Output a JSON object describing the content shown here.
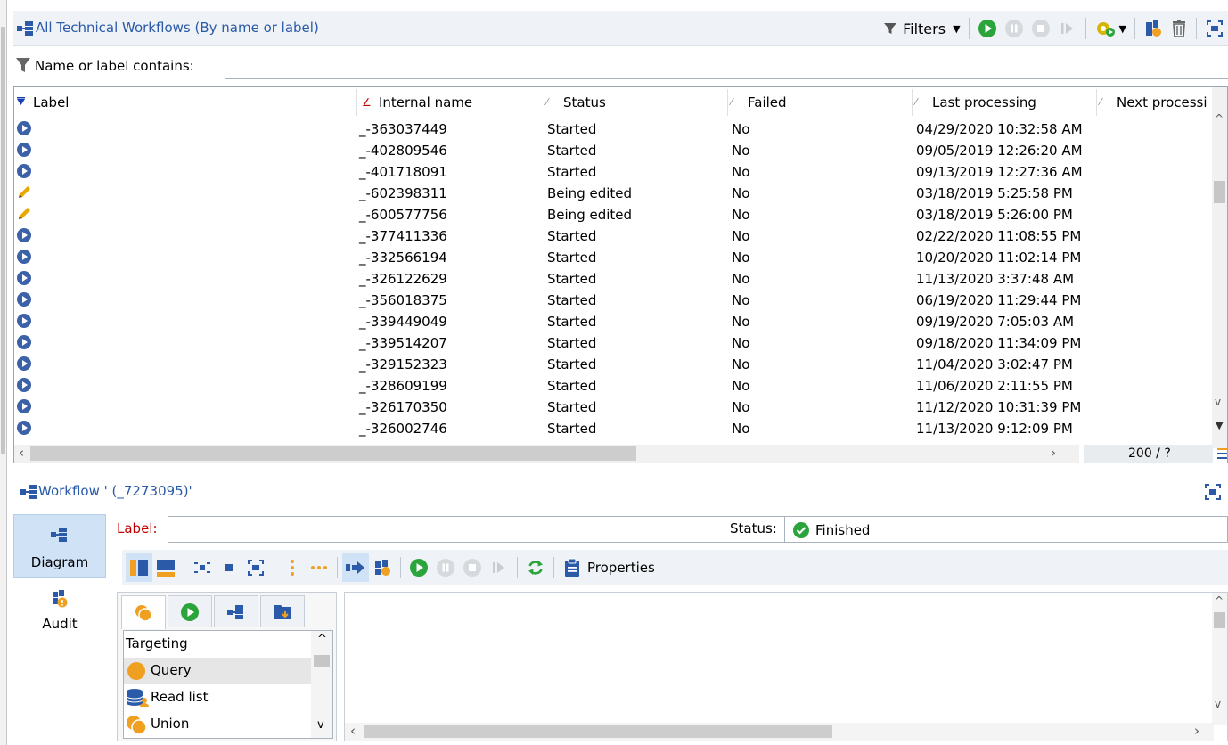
{
  "list_panel": {
    "title": "All Technical Workflows (By name or label)",
    "filters_label": "Filters",
    "filter_row": {
      "label": "Name or label contains:",
      "value": ""
    },
    "columns": [
      "Label",
      "Internal name",
      "Status",
      "Failed",
      "Last processing",
      "Next processi"
    ],
    "rows": [
      {
        "icon": "play-icon",
        "internal_name": "_-363037449",
        "status": "Started",
        "failed": "No",
        "last_processing": "04/29/2020 10:32:58 AM"
      },
      {
        "icon": "play-icon",
        "internal_name": "_-402809546",
        "status": "Started",
        "failed": "No",
        "last_processing": "09/05/2019 12:26:20 AM"
      },
      {
        "icon": "play-icon",
        "internal_name": "_-401718091",
        "status": "Started",
        "failed": "No",
        "last_processing": "09/13/2019 12:27:36 AM"
      },
      {
        "icon": "pencil-icon",
        "internal_name": "_-602398311",
        "status": "Being edited",
        "failed": "No",
        "last_processing": "03/18/2019 5:25:58 PM"
      },
      {
        "icon": "pencil-icon",
        "internal_name": "_-600577756",
        "status": "Being edited",
        "failed": "No",
        "last_processing": "03/18/2019 5:26:00 PM"
      },
      {
        "icon": "play-icon",
        "internal_name": "_-377411336",
        "status": "Started",
        "failed": "No",
        "last_processing": "02/22/2020 11:08:55 PM"
      },
      {
        "icon": "play-icon",
        "internal_name": "_-332566194",
        "status": "Started",
        "failed": "No",
        "last_processing": "10/20/2020 11:02:14 PM"
      },
      {
        "icon": "play-icon",
        "internal_name": "_-326122629",
        "status": "Started",
        "failed": "No",
        "last_processing": "11/13/2020 3:37:48 AM"
      },
      {
        "icon": "play-icon",
        "internal_name": "_-356018375",
        "status": "Started",
        "failed": "No",
        "last_processing": "06/19/2020 11:29:44 PM"
      },
      {
        "icon": "play-icon",
        "internal_name": "_-339449049",
        "status": "Started",
        "failed": "No",
        "last_processing": "09/19/2020 7:05:03 AM"
      },
      {
        "icon": "play-icon",
        "internal_name": "_-339514207",
        "status": "Started",
        "failed": "No",
        "last_processing": "09/18/2020 11:34:09 PM"
      },
      {
        "icon": "play-icon",
        "internal_name": "_-329152323",
        "status": "Started",
        "failed": "No",
        "last_processing": "11/04/2020 3:02:47 PM"
      },
      {
        "icon": "play-icon",
        "internal_name": "_-328609199",
        "status": "Started",
        "failed": "No",
        "last_processing": "11/06/2020 2:11:55 PM"
      },
      {
        "icon": "play-icon",
        "internal_name": "_-326170350",
        "status": "Started",
        "failed": "No",
        "last_processing": "11/12/2020 10:31:39 PM"
      },
      {
        "icon": "play-icon",
        "internal_name": "_-326002746",
        "status": "Started",
        "failed": "No",
        "last_processing": "11/13/2020 9:12:09 PM"
      }
    ],
    "counter": "200 / ?"
  },
  "detail_panel": {
    "title": "Workflow ' (_7273095)'",
    "nav": [
      {
        "label": "Diagram",
        "icon": "workflow-icon"
      },
      {
        "label": "Audit",
        "icon": "audit-icon"
      }
    ],
    "label_field": {
      "label": "Label:",
      "value": ""
    },
    "status_field": {
      "label": "Status:",
      "value": "Finished"
    },
    "properties_label": "Properties",
    "palette": {
      "items": [
        {
          "label": "Targeting",
          "icon": ""
        },
        {
          "label": "Query",
          "icon": "query-icon"
        },
        {
          "label": "Read list",
          "icon": "read-list-icon"
        },
        {
          "label": "Union",
          "icon": "union-icon"
        }
      ]
    }
  },
  "colors": {
    "accent": "#2a5aa8",
    "play": "#3b62a8",
    "start_green": "#2aa43b",
    "pencil": "#e8a800",
    "orange": "#f0a020",
    "label_red": "#c00000"
  }
}
